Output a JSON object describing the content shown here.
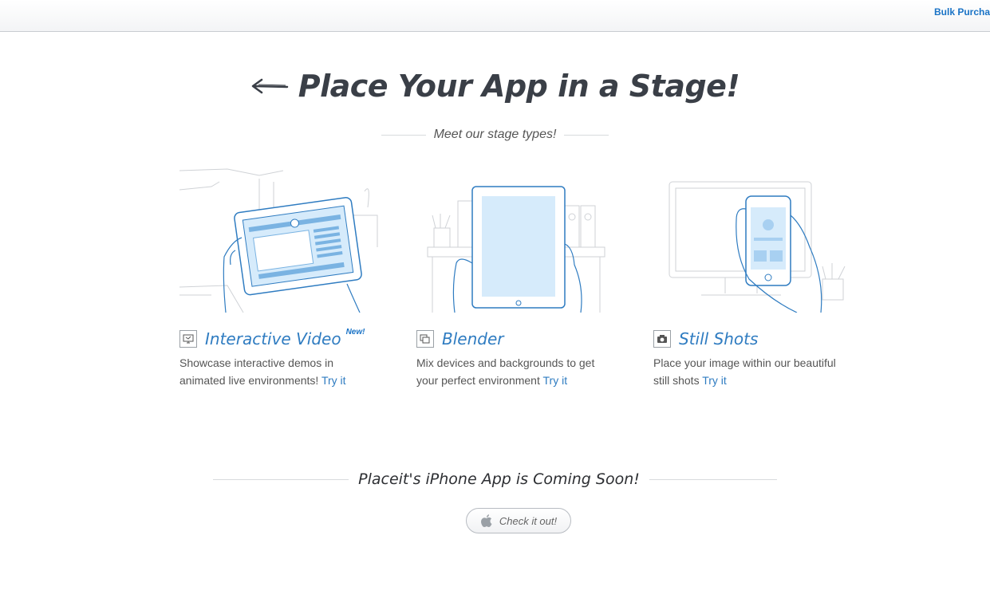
{
  "topbar": {
    "bulk_label": "Bulk Purchase"
  },
  "hero": {
    "title": "Place Your App in a Stage!",
    "subtitle": "Meet our stage types!"
  },
  "stages": [
    {
      "title": "Interactive Video",
      "badge": "New!",
      "desc": "Showcase interactive demos in animated live environments!",
      "link": "Try it",
      "icon": "monitor-icon"
    },
    {
      "title": "Blender",
      "desc": "Mix devices and backgrounds to get your perfect environment",
      "link": "Try it",
      "icon": "layers-icon"
    },
    {
      "title": "Still Shots",
      "desc": "Place your image within our beautiful still shots",
      "link": "Try it",
      "icon": "camera-icon"
    }
  ],
  "app_promo": {
    "text": "Placeit's iPhone App is Coming Soon!",
    "button_label": "Check it out!",
    "button_icon": "apple-icon"
  },
  "colors": {
    "accent": "#2f7cc1",
    "link": "#1a73c6",
    "heading": "#3a3f47",
    "illustration_fill": "#d6ebfb"
  }
}
